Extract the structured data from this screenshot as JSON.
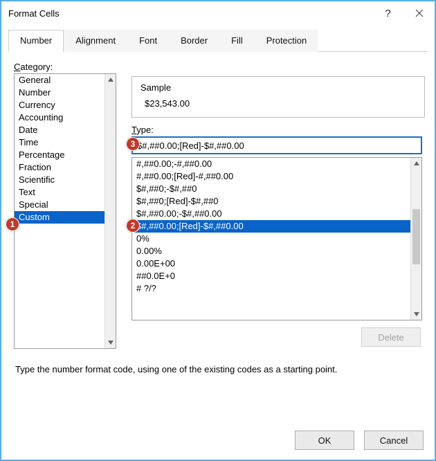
{
  "window": {
    "title": "Format Cells"
  },
  "tabs": [
    "Number",
    "Alignment",
    "Font",
    "Border",
    "Fill",
    "Protection"
  ],
  "active_tab": "Number",
  "categoryLabel": "Category:",
  "categories": [
    "General",
    "Number",
    "Currency",
    "Accounting",
    "Date",
    "Time",
    "Percentage",
    "Fraction",
    "Scientific",
    "Text",
    "Special",
    "Custom"
  ],
  "category_selected": "Custom",
  "sampleLabel": "Sample",
  "sampleValue": "$23,543.00",
  "typeLabel": "Type:",
  "typeValue": "$#,##0.00;[Red]-$#,##0.00",
  "types": [
    "#,##0.00;-#,##0.00",
    "#,##0.00;[Red]-#,##0.00",
    "$#,##0;-$#,##0",
    "$#,##0;[Red]-$#,##0",
    "$#,##0.00;-$#,##0.00",
    "$#,##0.00;[Red]-$#,##0.00",
    "0%",
    "0.00%",
    "0.00E+00",
    "##0.0E+0",
    "# ?/?"
  ],
  "type_selected_index": 5,
  "deleteLabel": "Delete",
  "hint": "Type the number format code, using one of the existing codes as a starting point.",
  "buttons": {
    "ok": "OK",
    "cancel": "Cancel"
  },
  "callouts": [
    "1",
    "2",
    "3"
  ]
}
